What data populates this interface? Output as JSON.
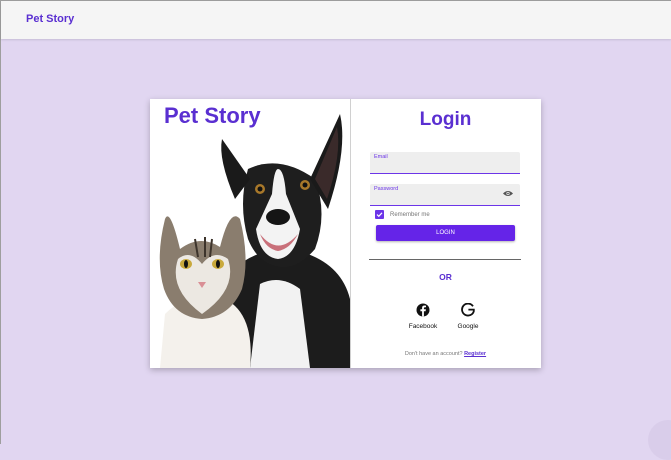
{
  "appbar": {
    "title": "Pet Story"
  },
  "hero": {
    "title": "Pet Story"
  },
  "login": {
    "title": "Login",
    "email_label": "Email",
    "password_label": "Password",
    "remember_label": "Remember me",
    "remember_checked": true,
    "button_label": "LOGIN",
    "or_text": "OR",
    "social": [
      {
        "label": "Facebook",
        "icon": "facebook-icon"
      },
      {
        "label": "Google",
        "icon": "google-icon"
      }
    ],
    "register_prompt": "Don't have an account?",
    "register_link": "Register"
  },
  "colors": {
    "accent": "#5a2fd1",
    "button": "#6524e8",
    "background": "#e1d6f1"
  }
}
